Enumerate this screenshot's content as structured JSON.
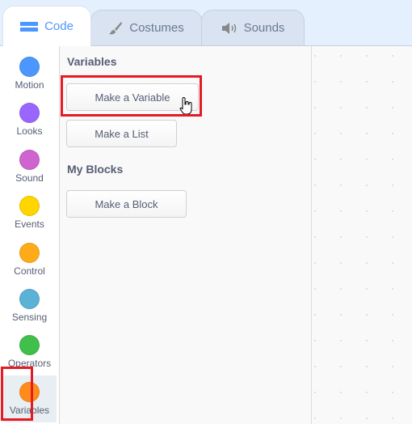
{
  "tabs": [
    {
      "label": "Code",
      "icon": "code-icon",
      "active": true
    },
    {
      "label": "Costumes",
      "icon": "brush-icon"
    },
    {
      "label": "Sounds",
      "icon": "speaker-icon"
    }
  ],
  "categories": [
    {
      "label": "Motion",
      "color": "#4c97ff"
    },
    {
      "label": "Looks",
      "color": "#9966ff"
    },
    {
      "label": "Sound",
      "color": "#cf63cf"
    },
    {
      "label": "Events",
      "color": "#ffd500"
    },
    {
      "label": "Control",
      "color": "#ffab19"
    },
    {
      "label": "Sensing",
      "color": "#5cb1d6"
    },
    {
      "label": "Operators",
      "color": "#40bf4a"
    },
    {
      "label": "Variables",
      "color": "#ff8c1a",
      "selected": true
    }
  ],
  "palette": {
    "variables_heading": "Variables",
    "make_variable": "Make a Variable",
    "make_list": "Make a List",
    "my_blocks_heading": "My Blocks",
    "make_block": "Make a Block"
  },
  "highlight_color": "#e41b23"
}
